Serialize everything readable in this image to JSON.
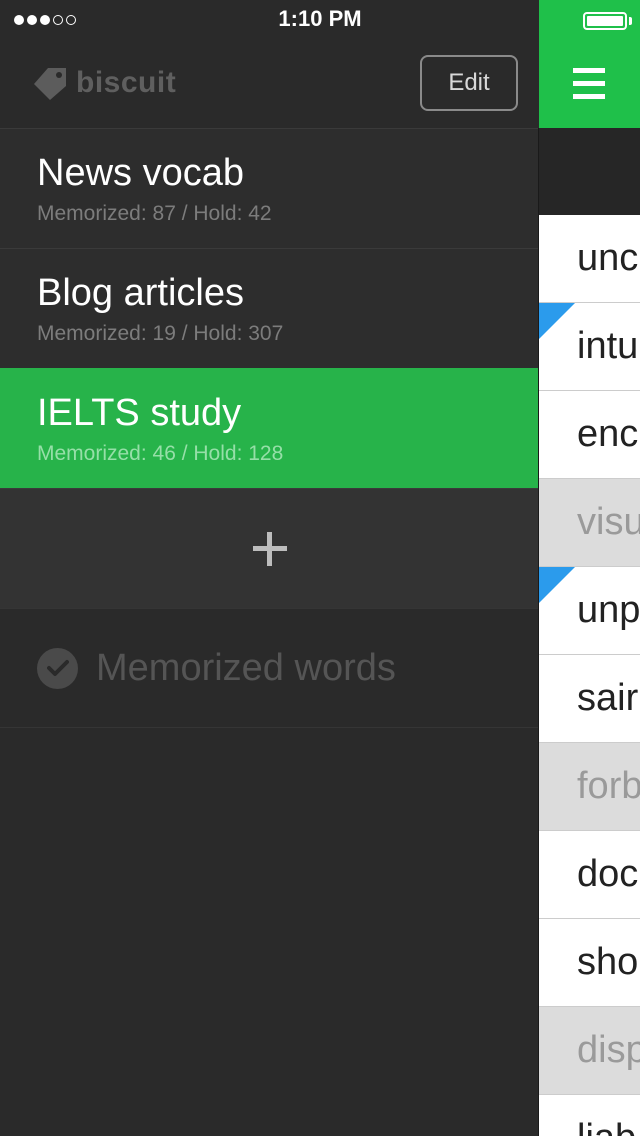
{
  "status_bar": {
    "signal_dots": [
      true,
      true,
      true,
      false,
      false
    ],
    "time": "1:10 PM",
    "battery_level": 1.0
  },
  "header": {
    "logo_text": "biscuit",
    "logo_icon": "tag-icon",
    "edit_label": "Edit"
  },
  "decks": [
    {
      "name": "News vocab",
      "stats": "Memorized: 87 / Hold: 42",
      "active": false
    },
    {
      "name": "Blog articles",
      "stats": "Memorized: 19 / Hold: 307",
      "active": false
    },
    {
      "name": "IELTS study",
      "stats": "Memorized: 46 / Hold: 128",
      "active": true
    }
  ],
  "add_deck": {
    "icon": "plus-icon"
  },
  "memorized_words": {
    "label": "Memorized words",
    "icon": "check-circle-icon"
  },
  "peek": {
    "menu_icon": "hamburger-menu-icon",
    "words": [
      {
        "text": "unc",
        "held": false,
        "flagged": false
      },
      {
        "text": "intu",
        "held": false,
        "flagged": true
      },
      {
        "text": "enc",
        "held": false,
        "flagged": false
      },
      {
        "text": "visu",
        "held": true,
        "flagged": false
      },
      {
        "text": "unp",
        "held": false,
        "flagged": true
      },
      {
        "text": "sair",
        "held": false,
        "flagged": false
      },
      {
        "text": "forb",
        "held": true,
        "flagged": false
      },
      {
        "text": "doc",
        "held": false,
        "flagged": false
      },
      {
        "text": "sho",
        "held": false,
        "flagged": false
      },
      {
        "text": "disp",
        "held": true,
        "flagged": false
      },
      {
        "text": "liab",
        "held": false,
        "flagged": false
      }
    ]
  },
  "colors": {
    "accent_green": "#27b34a",
    "topbar_green": "#1fc04a",
    "flag_blue": "#2b9bec",
    "drawer_bg": "#2a2a2a"
  }
}
